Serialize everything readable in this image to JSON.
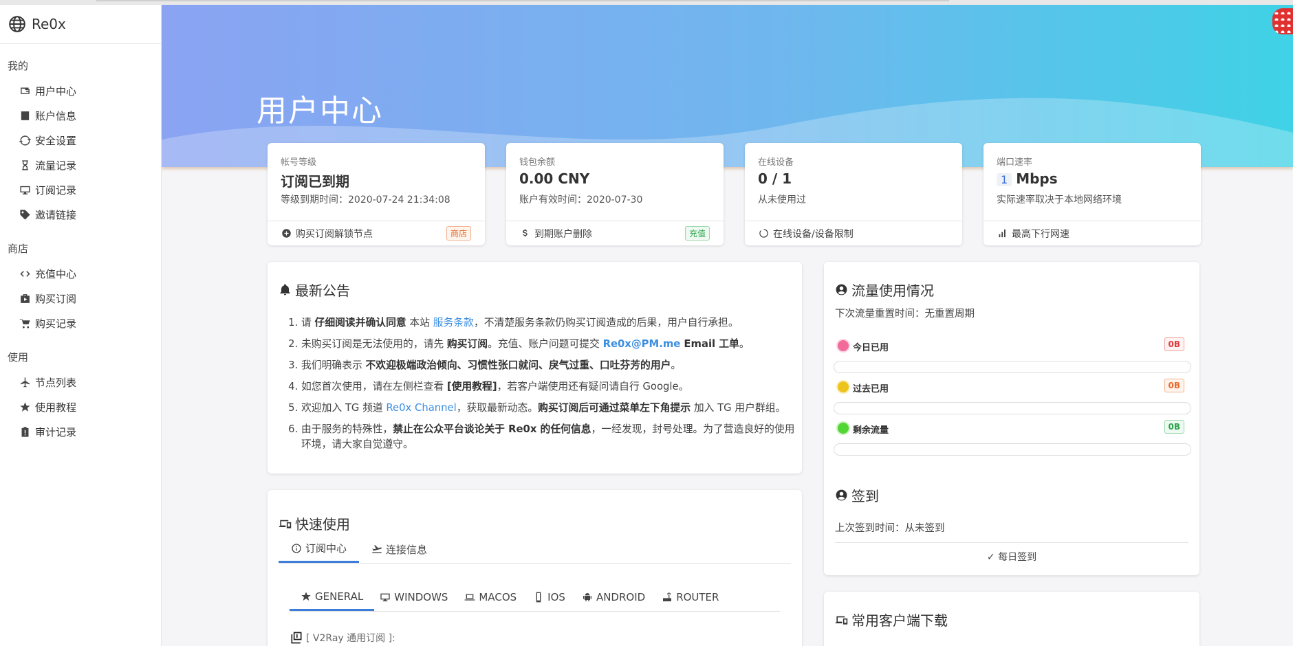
{
  "brand": "Re0x",
  "sidebar": {
    "sections": [
      {
        "title": "我的",
        "items": [
          "用户中心",
          "账户信息",
          "安全设置",
          "流量记录",
          "订阅记录",
          "邀请链接"
        ]
      },
      {
        "title": "商店",
        "items": [
          "充值中心",
          "购买订阅",
          "购买记录"
        ]
      },
      {
        "title": "使用",
        "items": [
          "节点列表",
          "使用教程",
          "审计记录"
        ]
      }
    ]
  },
  "header": {
    "title": "用户中心"
  },
  "cards": [
    {
      "label": "帐号等级",
      "value": "订阅已到期",
      "sub": "等级到期时间：2020-07-24 21:34:08",
      "footer": "购买订阅解锁节点",
      "badge": "商店"
    },
    {
      "label": "钱包余额",
      "value": "0.00 CNY",
      "sub": "账户有效时间：2020-07-30",
      "footer": "到期账户删除",
      "badge": "充值"
    },
    {
      "label": "在线设备",
      "value": "0 / 1",
      "sub": "从未使用过",
      "footer": "在线设备/设备限制"
    },
    {
      "label": "端口速率",
      "speed": "1",
      "unit": "Mbps",
      "sub": "实际速率取决于本地网络环境",
      "footer": "最高下行网速"
    }
  ],
  "announce": {
    "title": "最新公告",
    "items": {
      "i1": {
        "a": "请 ",
        "b": "仔细阅读并确认同意",
        "c": " 本站 ",
        "link": "服务条款",
        "d": "，不清楚服务条款仍购买订阅造成的后果，用户自行承担。"
      },
      "i2": {
        "a": "未购买订阅是无法使用的，请先 ",
        "b": "购买订阅",
        "c": "。充值、账户问题可提交 ",
        "link": "Re0x@PM.me",
        "d": " Email 工单",
        "e": "。"
      },
      "i3": {
        "a": "我们明确表示 ",
        "b": "不欢迎极端政治倾向、习惯性张口就问、戾气过重、口吐芬芳的用户",
        "c": "。"
      },
      "i4": {
        "a": "如您首次使用，请在左侧栏查看 ",
        "b": "[使用教程]",
        "c": "，若客户端使用还有疑问请自行 Google。"
      },
      "i5": {
        "a": "欢迎加入 TG 频道 ",
        "link": "Re0x Channel",
        "b": "，获取最新动态。",
        "c": "购买订阅后可通过菜单左下角提示",
        "d": " 加入 TG 用户群组。"
      },
      "i6": {
        "a": "由于服务的特殊性，",
        "b": "禁止在公众平台谈论关于 Re0x 的任何信息",
        "c": "，一经发现，封号处理。为了营造良好的使用环境，请大家自觉遵守。"
      }
    }
  },
  "traffic": {
    "title": "流量使用情况",
    "reset": "下次流量重置时间：无重置周期",
    "rows": [
      {
        "name": "今日已用",
        "value": "0B",
        "color": "#f0568a"
      },
      {
        "name": "过去已用",
        "value": "0B",
        "color": "#f0c419"
      },
      {
        "name": "剩余流量",
        "value": "0B",
        "color": "#4cd32b"
      }
    ]
  },
  "checkin": {
    "title": "签到",
    "last": "上次签到时间：从未签到",
    "button": "✓ 每日签到"
  },
  "quick": {
    "title": "快速使用",
    "tabs": [
      "订阅中心",
      "连接信息"
    ],
    "platforms": [
      "GENERAL",
      "WINDOWS",
      "MACOS",
      "IOS",
      "ANDROID",
      "ROUTER"
    ],
    "sub_label": "[ V2Ray 通用订阅 ]:"
  },
  "downloads": {
    "title": "常用客户端下载"
  }
}
